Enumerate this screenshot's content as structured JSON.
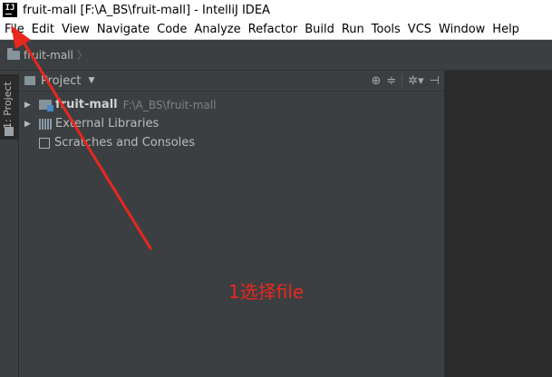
{
  "window": {
    "title": "fruit-mall [F:\\A_BS\\fruit-mall] - IntelliJ IDEA",
    "app_icon_text": "IJ"
  },
  "menu": [
    "File",
    "Edit",
    "View",
    "Navigate",
    "Code",
    "Analyze",
    "Refactor",
    "Build",
    "Run",
    "Tools",
    "VCS",
    "Window",
    "Help"
  ],
  "navbar": {
    "breadcrumb": "fruit-mall"
  },
  "sidebar": {
    "tab_label": "1: Project"
  },
  "project_panel": {
    "title": "Project",
    "tools": [
      "target-icon",
      "collapse-icon",
      "gear-icon",
      "hide-icon"
    ],
    "tree": [
      {
        "label": "fruit-mall",
        "path": "F:\\A_BS\\fruit-mall",
        "bold": true,
        "expandable": true
      },
      {
        "label": "External Libraries",
        "expandable": true
      },
      {
        "label": "Scratches and Consoles",
        "expandable": false
      }
    ]
  },
  "annotation": {
    "text": "1选择file",
    "color": "#e8271e"
  }
}
